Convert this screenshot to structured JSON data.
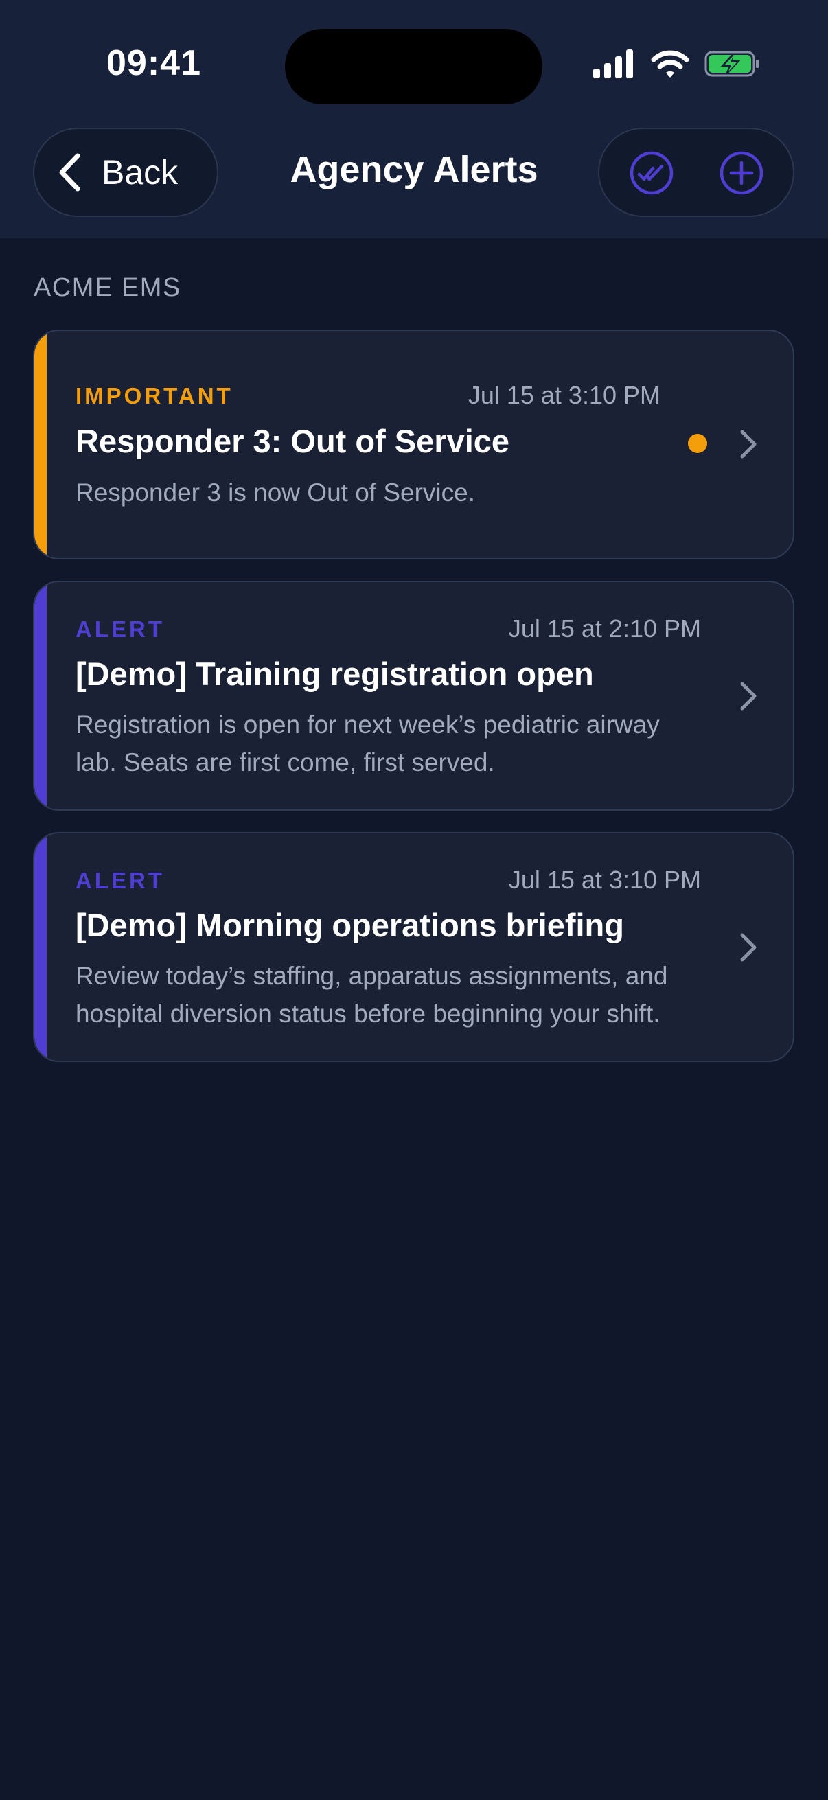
{
  "status_bar": {
    "time": "09:41"
  },
  "nav": {
    "back_label": "Back",
    "title": "Agency Alerts",
    "actions": [
      {
        "icon": "mark-all-read-icon"
      },
      {
        "icon": "add-icon"
      }
    ]
  },
  "section": {
    "title": "ACME EMS"
  },
  "colors": {
    "important": "#f59e0b",
    "alert": "#4f3ed1",
    "background": "#10172a",
    "card": "#1a2134"
  },
  "alerts": [
    {
      "level": "IMPORTANT",
      "time": "Jul 15 at 3:10 PM",
      "title": "Responder 3: Out of Service",
      "body": "Responder 3 is now Out of Service.",
      "unread": true
    },
    {
      "level": "ALERT",
      "time": "Jul 15 at 2:10 PM",
      "title": "[Demo] Training registration open",
      "body": "Registration is open for next week’s pediatric airway lab. Seats are first come, first served.",
      "unread": false
    },
    {
      "level": "ALERT",
      "time": "Jul 15 at 3:10 PM",
      "title": "[Demo] Morning operations briefing",
      "body": "Review today’s staffing, apparatus assignments, and hospital diversion status before beginning your shift.",
      "unread": false
    }
  ]
}
